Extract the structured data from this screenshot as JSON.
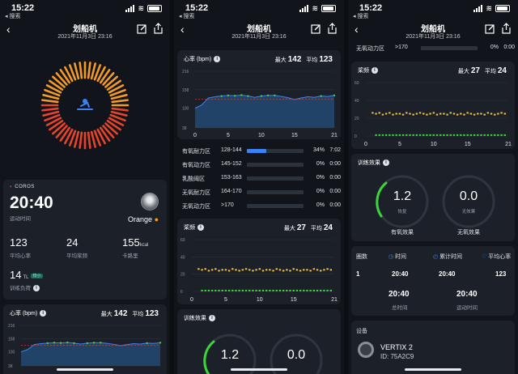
{
  "status_bar": {
    "time": "15:22",
    "back_label": "◂ 搜索"
  },
  "nav": {
    "title": "划船机",
    "datetime": "2021年11月3日 23:16"
  },
  "summary": {
    "brand": "COROS",
    "duration": "20:40",
    "duration_label": "运动时间",
    "user_name": "Orange",
    "avg_hr": "123",
    "avg_hr_label": "平均心率",
    "avg_stroke": "24",
    "avg_stroke_label": "平均桨频",
    "calories": "155",
    "calories_unit": "kcal",
    "calories_label": "卡路里",
    "training_load": "14",
    "training_load_unit": "TL",
    "training_load_badge": "较小",
    "training_load_label": "训练负荷"
  },
  "hr_chart": {
    "title": "心率 (bpm)",
    "max_label": "最大",
    "max_value": "142",
    "avg_label": "平均",
    "avg_value": "123",
    "x_ticks": [
      "0",
      "5",
      "10",
      "15",
      "21"
    ],
    "y_ticks": [
      "216",
      "158",
      "100",
      "38"
    ]
  },
  "zones": [
    {
      "name": "有氧耐力区",
      "range": "128-144",
      "pct": "34%",
      "time": "7:02",
      "fill": 0.34
    },
    {
      "name": "有氧动力区",
      "range": "145-152",
      "pct": "0%",
      "time": "0:00",
      "fill": 0
    },
    {
      "name": "乳酸阈区",
      "range": "153-163",
      "pct": "0%",
      "time": "0:00",
      "fill": 0
    },
    {
      "name": "无氧耐力区",
      "range": "164-170",
      "pct": "0%",
      "time": "0:00",
      "fill": 0
    },
    {
      "name": "无氧动力区",
      "range": ">170",
      "pct": "0%",
      "time": "0:00",
      "fill": 0
    }
  ],
  "stroke_chart": {
    "title": "桨频",
    "max_label": "最大",
    "max_value": "27",
    "avg_label": "平均",
    "avg_value": "24",
    "x_ticks": [
      "0",
      "5",
      "10",
      "15",
      "21"
    ],
    "y_ticks": [
      "60",
      "40",
      "20",
      "0"
    ]
  },
  "training_effect": {
    "title": "训练效果",
    "aerobic_value": "1.2",
    "aerobic_sub": "恢复",
    "aerobic_label": "有氧效果",
    "anaerobic_value": "0.0",
    "anaerobic_sub": "无效果",
    "anaerobic_label": "无氧效果"
  },
  "laps": {
    "headers": [
      "圈数",
      "时间",
      "累计时间",
      "平均心率"
    ],
    "row": [
      "1",
      "20:40",
      "20:40",
      "123"
    ],
    "total_time": "20:40",
    "total_time_label": "总时间",
    "moving_time": "20:40",
    "moving_time_label": "运动时间"
  },
  "device": {
    "title": "设备",
    "name": "VERTIX 2",
    "id": "ID: 75A2C9"
  },
  "colors": {
    "accent_blue": "#3b82f6",
    "green": "#3ad63a",
    "yellow": "#f5c242",
    "orange_ring": "#f39a27",
    "red_ring": "#e8432b"
  },
  "chart_data": [
    {
      "type": "area",
      "title": "心率 (bpm)",
      "x": [
        0,
        1,
        2,
        3,
        4,
        5,
        6,
        7,
        8,
        9,
        10,
        11,
        12,
        13,
        14,
        15,
        16,
        17,
        18,
        19,
        20,
        21
      ],
      "y": [
        100,
        110,
        132,
        136,
        138,
        140,
        139,
        141,
        138,
        134,
        138,
        140,
        140,
        137,
        133,
        127,
        132,
        136,
        134,
        138,
        137,
        140
      ],
      "ylim": [
        38,
        216
      ],
      "xlim": [
        0,
        21
      ]
    },
    {
      "type": "scatter",
      "title": "桨频",
      "series": [
        {
          "name": "",
          "color": "#f5c242",
          "x": [
            1,
            1.5,
            2,
            2.5,
            3,
            3.5,
            4,
            4.5,
            5,
            5.5,
            6,
            6.5,
            7,
            7.5,
            8,
            8.5,
            9,
            9.5,
            10,
            10.5,
            11,
            11.5,
            12,
            12.5,
            13,
            13.5,
            14,
            14.5,
            15,
            15.5,
            16,
            16.5,
            17,
            17.5,
            18,
            18.5,
            19,
            19.5,
            20,
            20.5
          ],
          "y": [
            26,
            25,
            26,
            24,
            25,
            26,
            24,
            25,
            25,
            24,
            26,
            25,
            24,
            25,
            26,
            25,
            24,
            25,
            26,
            24,
            25,
            25,
            24,
            26,
            25,
            24,
            25,
            24,
            26,
            25,
            24,
            25,
            25,
            24,
            26,
            25,
            24,
            25,
            26,
            25
          ]
        },
        {
          "name": "",
          "color": "#3ad63a",
          "x": [
            1.5,
            2,
            2.5,
            3,
            3.5,
            4,
            4.5,
            5,
            5.5,
            6,
            6.5,
            7,
            7.5,
            8,
            8.5,
            9,
            9.5,
            10,
            10.5,
            11,
            11.5,
            12,
            12.5,
            13,
            13.5,
            14,
            14.5,
            15,
            15.5,
            16,
            16.5,
            17,
            17.5,
            18,
            18.5,
            19,
            19.5,
            20,
            20.5
          ],
          "y": [
            1,
            1,
            1,
            1,
            1,
            1,
            1,
            1,
            1,
            1,
            1,
            1,
            1,
            1,
            1,
            1,
            1,
            1,
            1,
            1,
            1,
            1,
            1,
            1,
            1,
            1,
            1,
            1,
            1,
            1,
            1,
            1,
            1,
            1,
            1,
            1,
            1,
            1,
            1
          ]
        }
      ],
      "xlim": [
        0,
        21
      ],
      "ylim": [
        0,
        60
      ]
    }
  ]
}
